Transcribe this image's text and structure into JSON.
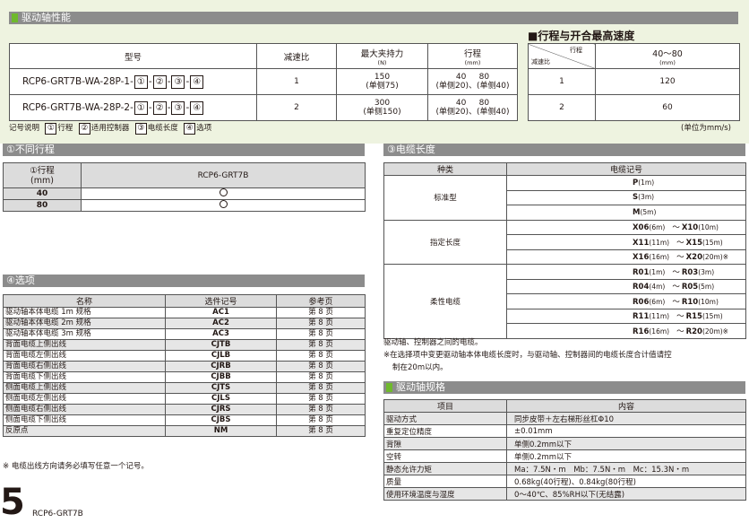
{
  "sections": {
    "performance": "驱动轴性能",
    "stroke_speed": "■行程与开合最高速度",
    "strokes": "①不同行程",
    "cable": "③电缆长度",
    "options": "④选项",
    "spec": "驱动轴规格"
  },
  "perf_table": {
    "headers": {
      "model": "型号",
      "ratio": "减速比",
      "force": "最大夹持力",
      "force_unit": "(N)",
      "stroke": "行程",
      "stroke_unit": "(mm)"
    },
    "rows": [
      {
        "model_prefix": "RCP6-GRT7B-WA-28P-1-",
        "ratio": "1",
        "force": "150",
        "force_sub": "(单侧75)",
        "stroke_a": "40",
        "stroke_b": "80",
        "stroke_sub": "(单侧20)、(单侧40)"
      },
      {
        "model_prefix": "RCP6-GRT7B-WA-28P-2-",
        "ratio": "2",
        "force": "300",
        "force_sub": "(单侧150)",
        "stroke_a": "40",
        "stroke_b": "80",
        "stroke_sub": "(单侧20)、(单侧40)"
      }
    ],
    "circles": [
      "①",
      "②",
      "③",
      "④"
    ],
    "dash": "-"
  },
  "legend": {
    "label": "记号说明",
    "items": [
      {
        "circle": "①",
        "text": "行程"
      },
      {
        "circle": "②",
        "text": "适用控制器"
      },
      {
        "circle": "③",
        "text": "电缆长度"
      },
      {
        "circle": "④",
        "text": "选项"
      }
    ]
  },
  "speed_table": {
    "corner_top": "行程",
    "corner_bottom": "减速比",
    "col": "40〜80",
    "col_unit": "(mm)",
    "rows": [
      {
        "ratio": "1",
        "value": "120"
      },
      {
        "ratio": "2",
        "value": "60"
      }
    ],
    "unit_note": "(单位为mm/s)"
  },
  "stroke_table": {
    "header_a": "①行程",
    "header_a_unit": "(mm)",
    "header_b": "RCP6-GRT7B",
    "rows": [
      {
        "stroke": "40"
      },
      {
        "stroke": "80"
      }
    ]
  },
  "options_table": {
    "headers": [
      "名称",
      "选件记号",
      "参考页"
    ],
    "rows": [
      [
        "驱动轴本体电缆 1m 规格",
        "AC1",
        "第 8 页"
      ],
      [
        "驱动轴本体电缆 2m 规格",
        "AC2",
        "第 8 页"
      ],
      [
        "驱动轴本体电缆 3m 规格",
        "AC3",
        "第 8 页"
      ],
      [
        "背面电缆上侧出线",
        "CJTB",
        "第 8 页"
      ],
      [
        "背面电缆左侧出线",
        "CJLB",
        "第 8 页"
      ],
      [
        "背面电缆右侧出线",
        "CJRB",
        "第 8 页"
      ],
      [
        "背面电缆下侧出线",
        "CJBB",
        "第 8 页"
      ],
      [
        "侧面电缆上侧出线",
        "CJTS",
        "第 8 页"
      ],
      [
        "侧面电缆左侧出线",
        "CJLS",
        "第 8 页"
      ],
      [
        "侧面电缆右侧出线",
        "CJRS",
        "第 8 页"
      ],
      [
        "侧面电缆下侧出线",
        "CJBS",
        "第 8 页"
      ],
      [
        "反原点",
        "NM",
        "第 8 页"
      ]
    ],
    "note": "※ 电缆出线方向请务必填写任意一个记号。"
  },
  "cable_table": {
    "headers": [
      "种类",
      "电缆记号"
    ],
    "groups": [
      {
        "type": "标准型",
        "rows": [
          [
            {
              "code": "P",
              "len": "(1m)"
            }
          ],
          [
            {
              "code": "S",
              "len": "(3m)"
            }
          ],
          [
            {
              "code": "M",
              "len": "(5m)"
            }
          ]
        ]
      },
      {
        "type": "指定长度",
        "rows": [
          [
            {
              "code": "X06",
              "len": "(6m)"
            },
            {
              "code": "X10",
              "len": "(10m)"
            }
          ],
          [
            {
              "code": "X11",
              "len": "(11m)"
            },
            {
              "code": "X15",
              "len": "(15m)"
            }
          ],
          [
            {
              "code": "X16",
              "len": "(16m)"
            },
            {
              "code": "X20",
              "len": "(20m)※"
            }
          ]
        ]
      },
      {
        "type": "柔性电缆",
        "rows": [
          [
            {
              "code": "R01",
              "len": "(1m)"
            },
            {
              "code": "R03",
              "len": "(3m)"
            }
          ],
          [
            {
              "code": "R04",
              "len": "(4m)"
            },
            {
              "code": "R05",
              "len": "(5m)"
            }
          ],
          [
            {
              "code": "R06",
              "len": "(6m)"
            },
            {
              "code": "R10",
              "len": "(10m)"
            }
          ],
          [
            {
              "code": "R11",
              "len": "(11m)"
            },
            {
              "code": "R15",
              "len": "(15m)"
            }
          ],
          [
            {
              "code": "R16",
              "len": "(16m)"
            },
            {
              "code": "R20",
              "len": "(20m)※"
            }
          ]
        ]
      }
    ],
    "tilde": "〜",
    "note1": "驱动轴、控制器之间的电缆。",
    "note2": "※在选择项中变更驱动轴本体电缆长度时，与驱动轴、控制器间的电缆长度合计值请控",
    "note3": "制在20m以内。"
  },
  "spec_table": {
    "headers": [
      "项目",
      "内容"
    ],
    "rows": [
      [
        "驱动方式",
        "同步皮带＋左右梯形丝杠Φ10"
      ],
      [
        "重复定位精度",
        "±0.01mm"
      ],
      [
        "背隙",
        "单侧0.2mm以下"
      ],
      [
        "空转",
        "单侧0.2mm以下"
      ],
      [
        "静态允许力矩",
        "Ma：7.5N・m　Mb：7.5N・m　Mc：15.3N・m"
      ],
      [
        "质量",
        "0.68kg(40行程)、0.84kg(80行程)"
      ],
      [
        "使用环境温度与湿度",
        "0〜40℃、85%RH以下(无结露)"
      ]
    ]
  },
  "footer": {
    "page": "5",
    "model": "RCP6-GRT7B"
  }
}
